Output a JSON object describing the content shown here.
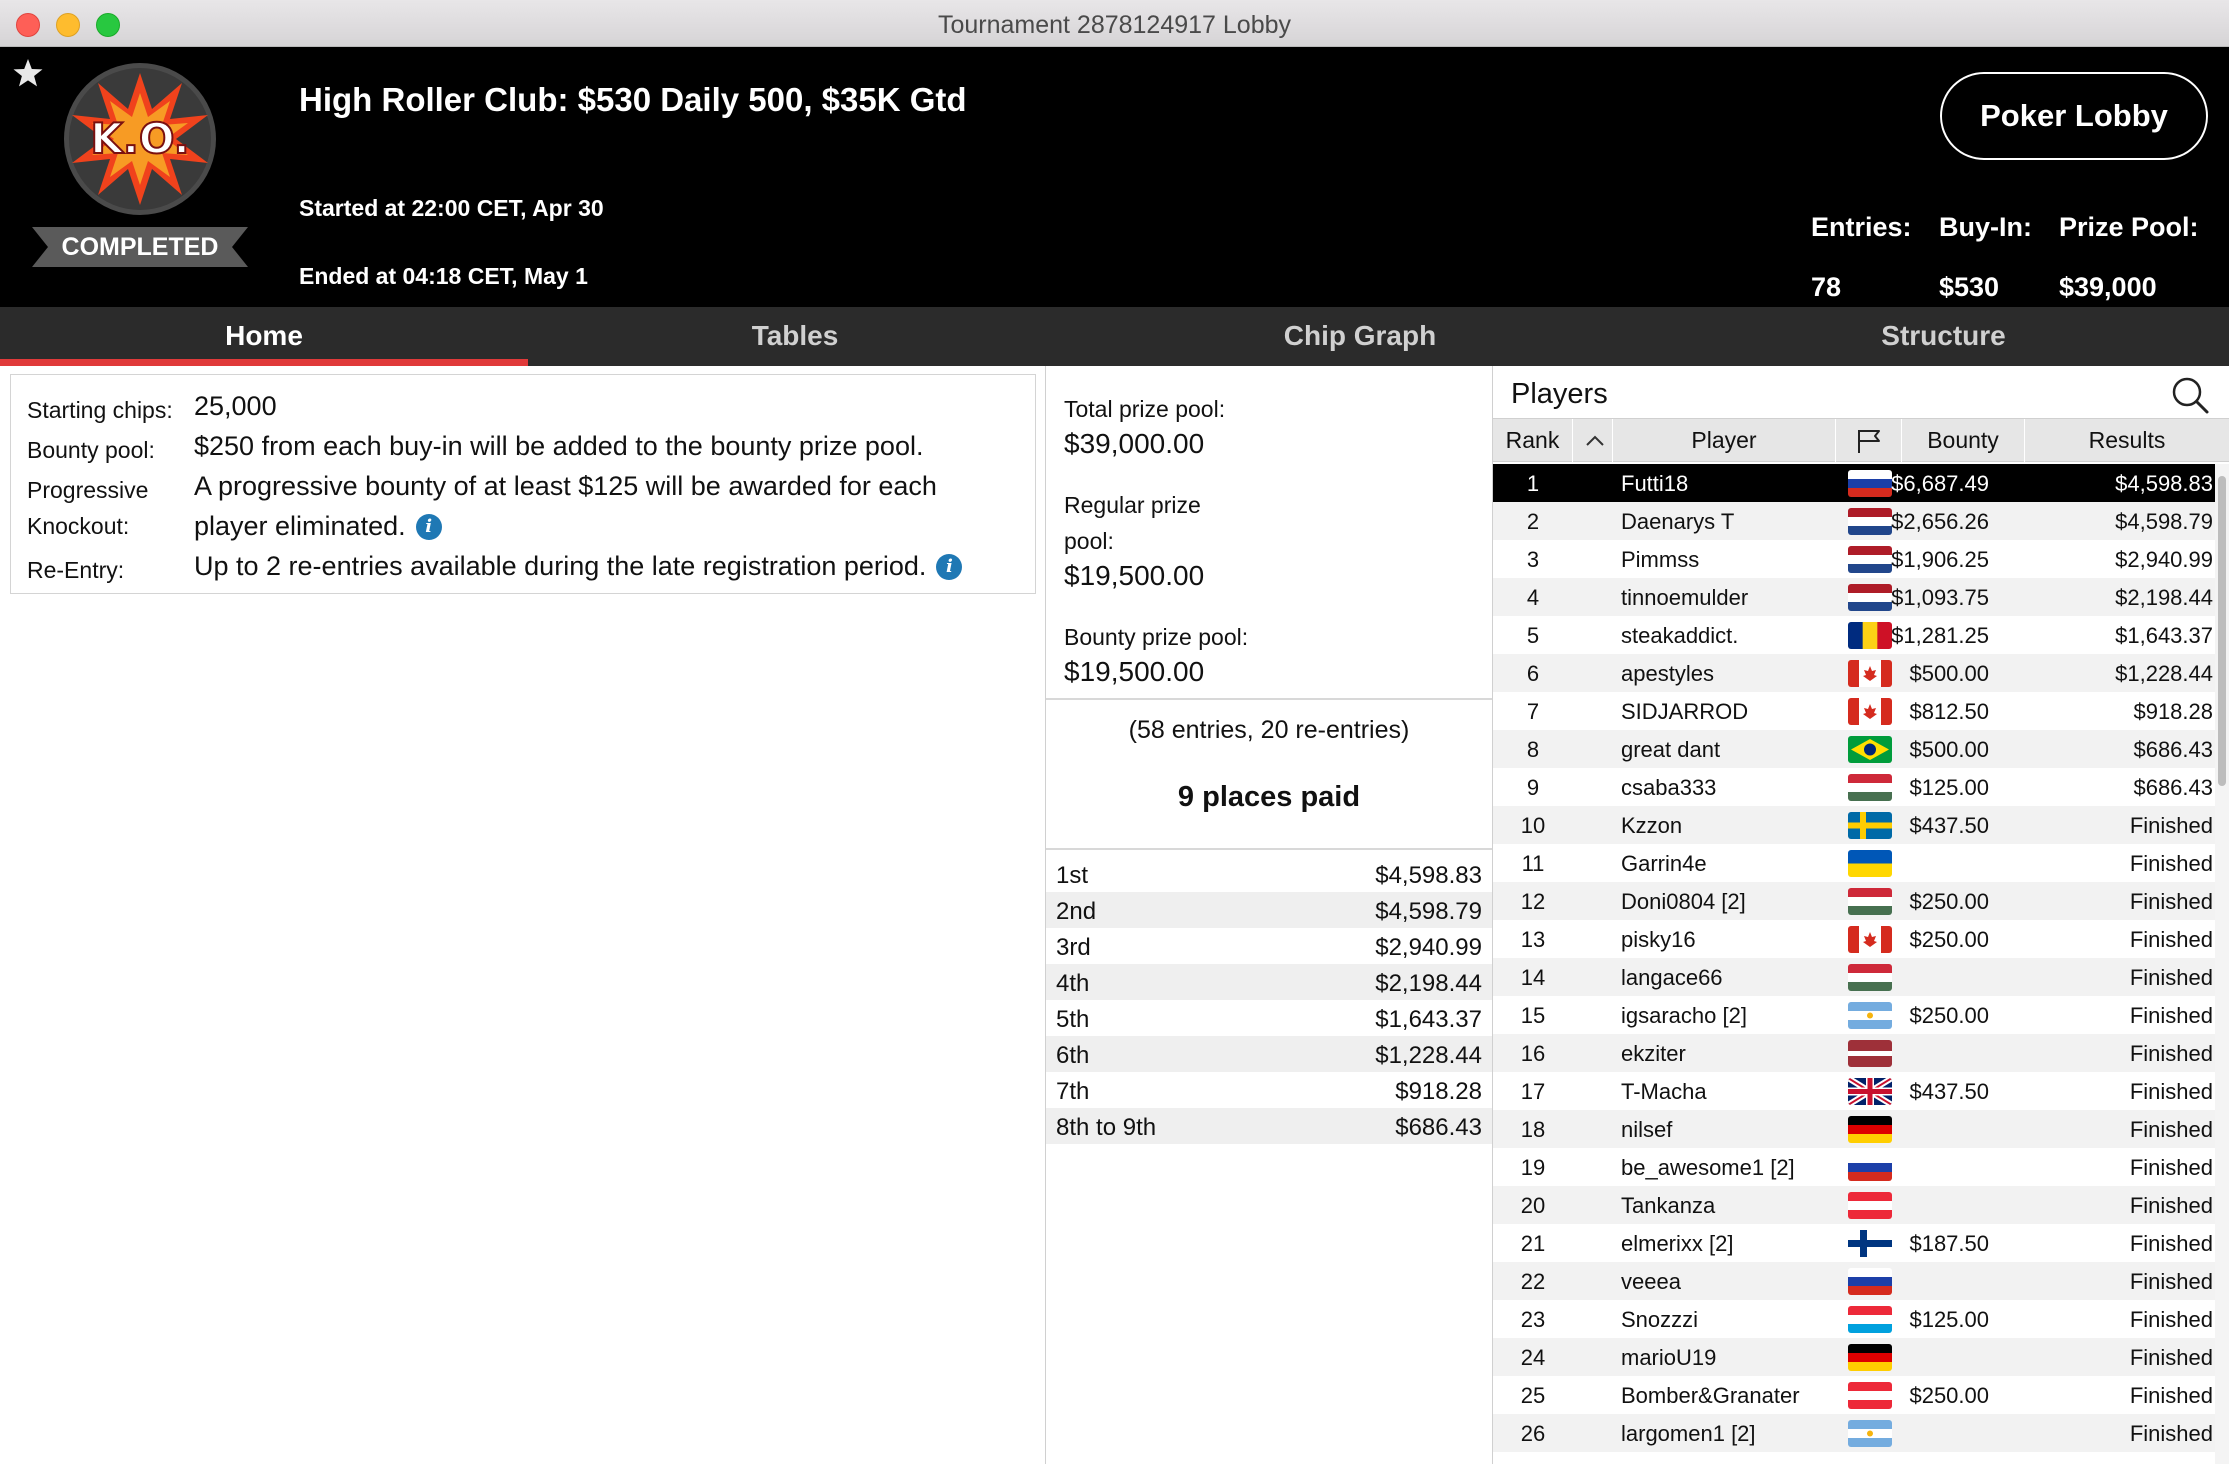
{
  "window": {
    "title": "Tournament 2878124917 Lobby"
  },
  "header": {
    "tournament_name": "High Roller Club: $530 Daily 500, $35K Gtd",
    "started": "Started at 22:00 CET, Apr 30",
    "ended": "Ended at 04:18 CET, May 1",
    "status": "COMPLETED",
    "logo_text": "K.O.",
    "lobby_button": "Poker Lobby",
    "stats": [
      {
        "label": "Entries:",
        "value": "78"
      },
      {
        "label": "Buy-In:",
        "value": "$530"
      },
      {
        "label": "Prize Pool:",
        "value": "$39,000"
      }
    ]
  },
  "tabs": [
    {
      "label": "Home",
      "active": true
    },
    {
      "label": "Tables",
      "active": false
    },
    {
      "label": "Chip Graph",
      "active": false
    },
    {
      "label": "Structure",
      "active": false
    }
  ],
  "info": {
    "starting_chips_label": "Starting chips:",
    "starting_chips_value": "25,000",
    "bounty_pool_label": "Bounty pool:",
    "bounty_pool_value": "$250 from each buy-in will be added to the bounty prize pool.",
    "pko_label_1": "Progressive",
    "pko_label_2": "Knockout:",
    "pko_value_1": "A progressive bounty of at least $125 will be awarded for each",
    "pko_value_2": "player eliminated.",
    "reentry_label": "Re-Entry:",
    "reentry_value": "Up to 2 re-entries available during the late registration period."
  },
  "prizes": {
    "total_label": "Total prize pool:",
    "total_value": "$39,000.00",
    "regular_label_1": "Regular prize",
    "regular_label_2": "pool:",
    "regular_value": "$19,500.00",
    "bounty_label": "Bounty prize pool:",
    "bounty_value": "$19,500.00",
    "entries_note": "(58 entries, 20 re-entries)",
    "places_paid": "9 places paid",
    "payouts": [
      {
        "place": "1st",
        "amount": "$4,598.83"
      },
      {
        "place": "2nd",
        "amount": "$4,598.79"
      },
      {
        "place": "3rd",
        "amount": "$2,940.99"
      },
      {
        "place": "4th",
        "amount": "$2,198.44"
      },
      {
        "place": "5th",
        "amount": "$1,643.37"
      },
      {
        "place": "6th",
        "amount": "$1,228.44"
      },
      {
        "place": "7th",
        "amount": "$918.28"
      },
      {
        "place": "8th to 9th",
        "amount": "$686.43"
      }
    ]
  },
  "players": {
    "title": "Players",
    "columns": {
      "rank": "Rank",
      "player": "Player",
      "bounty": "Bounty",
      "results": "Results"
    },
    "rows": [
      {
        "rank": "1",
        "player": "Futti18",
        "flag": "russia",
        "bounty": "$6,687.49",
        "results": "$4,598.83"
      },
      {
        "rank": "2",
        "player": "Daenarys T",
        "flag": "netherlands",
        "bounty": "$2,656.26",
        "results": "$4,598.79"
      },
      {
        "rank": "3",
        "player": "Pimmss",
        "flag": "netherlands",
        "bounty": "$1,906.25",
        "results": "$2,940.99"
      },
      {
        "rank": "4",
        "player": "tinnoemulder",
        "flag": "netherlands",
        "bounty": "$1,093.75",
        "results": "$2,198.44"
      },
      {
        "rank": "5",
        "player": "steakaddict.",
        "flag": "romania",
        "bounty": "$1,281.25",
        "results": "$1,643.37"
      },
      {
        "rank": "6",
        "player": "apestyles",
        "flag": "canada",
        "bounty": "$500.00",
        "results": "$1,228.44"
      },
      {
        "rank": "7",
        "player": "SIDJARROD",
        "flag": "canada",
        "bounty": "$812.50",
        "results": "$918.28"
      },
      {
        "rank": "8",
        "player": "great dant",
        "flag": "brazil",
        "bounty": "$500.00",
        "results": "$686.43"
      },
      {
        "rank": "9",
        "player": "csaba333",
        "flag": "hungary",
        "bounty": "$125.00",
        "results": "$686.43"
      },
      {
        "rank": "10",
        "player": "Kzzon",
        "flag": "sweden",
        "bounty": "$437.50",
        "results": "Finished"
      },
      {
        "rank": "11",
        "player": "Garrin4e",
        "flag": "ukraine",
        "bounty": "",
        "results": "Finished"
      },
      {
        "rank": "12",
        "player": "Doni0804 [2]",
        "flag": "hungary",
        "bounty": "$250.00",
        "results": "Finished"
      },
      {
        "rank": "13",
        "player": "pisky16",
        "flag": "canada",
        "bounty": "$250.00",
        "results": "Finished"
      },
      {
        "rank": "14",
        "player": "langace66",
        "flag": "hungary",
        "bounty": "",
        "results": "Finished"
      },
      {
        "rank": "15",
        "player": "igsaracho [2]",
        "flag": "argentina",
        "bounty": "$250.00",
        "results": "Finished"
      },
      {
        "rank": "16",
        "player": "ekziter",
        "flag": "latvia",
        "bounty": "",
        "results": "Finished"
      },
      {
        "rank": "17",
        "player": "T-Macha",
        "flag": "uk",
        "bounty": "$437.50",
        "results": "Finished"
      },
      {
        "rank": "18",
        "player": "nilsef",
        "flag": "germany",
        "bounty": "",
        "results": "Finished"
      },
      {
        "rank": "19",
        "player": "be_awesome1 [2]",
        "flag": "russia",
        "bounty": "",
        "results": "Finished"
      },
      {
        "rank": "20",
        "player": "Tankanza",
        "flag": "austria",
        "bounty": "",
        "results": "Finished"
      },
      {
        "rank": "21",
        "player": "elmerixx [2]",
        "flag": "finland",
        "bounty": "$187.50",
        "results": "Finished"
      },
      {
        "rank": "22",
        "player": "veeea",
        "flag": "russia",
        "bounty": "",
        "results": "Finished"
      },
      {
        "rank": "23",
        "player": "Snozzzi",
        "flag": "luxembourg",
        "bounty": "$125.00",
        "results": "Finished"
      },
      {
        "rank": "24",
        "player": "marioU19",
        "flag": "germany",
        "bounty": "",
        "results": "Finished"
      },
      {
        "rank": "25",
        "player": "Bomber&Granater",
        "flag": "austria",
        "bounty": "$250.00",
        "results": "Finished"
      },
      {
        "rank": "26",
        "player": "largomen1 [2]",
        "flag": "argentina",
        "bounty": "",
        "results": "Finished"
      }
    ]
  },
  "colors": {
    "accent_red": "#e03a3a",
    "header_bg": "#000000",
    "tab_bg": "#2b2b2b",
    "info_icon": "#1f78b4"
  },
  "icons": [
    "star-icon",
    "search-icon",
    "flag-icon",
    "sort-ascending-icon",
    "info-icon"
  ]
}
